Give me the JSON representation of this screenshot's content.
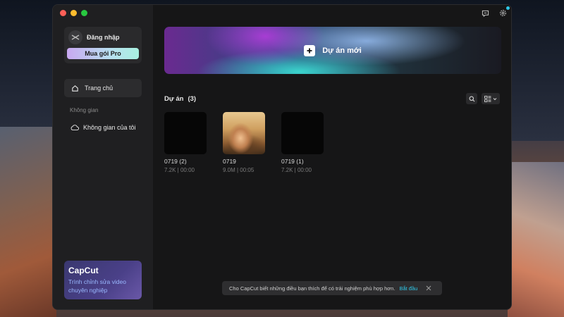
{
  "sidebar": {
    "login_label": "Đăng nhập",
    "pro_button": "Mua gói Pro",
    "home_label": "Trang chủ",
    "section_label": "Không gian",
    "space_label": "Không gian của tôi",
    "promo": {
      "brand": "CapCut",
      "subtitle": "Trình chỉnh sửa video chuyên nghiệp"
    }
  },
  "main": {
    "new_project_label": "Dự án mới",
    "projects_title": "Dự án",
    "projects_count": "(3)",
    "projects": [
      {
        "name": "0719 (2)",
        "meta": "7.2K | 00:00",
        "thumbnail": "black"
      },
      {
        "name": "0719",
        "meta": "9.0M | 00:05",
        "thumbnail": "photo"
      },
      {
        "name": "0719 (1)",
        "meta": "7.2K | 00:00",
        "thumbnail": "black"
      }
    ]
  },
  "toast": {
    "message": "Cho CapCut biết những điều bạn thích để có trải nghiệm phù hợp hơn.",
    "cta": "Bắt đầu"
  },
  "colors": {
    "accent": "#2fc8e8",
    "window_bg": "#161617",
    "sidebar_bg": "#1f1f21"
  },
  "icons": [
    "home-icon",
    "cloud-icon",
    "search-icon",
    "grid-view-icon",
    "feedback-icon",
    "settings-icon",
    "plus-icon",
    "close-icon",
    "capcut-logo-icon"
  ]
}
